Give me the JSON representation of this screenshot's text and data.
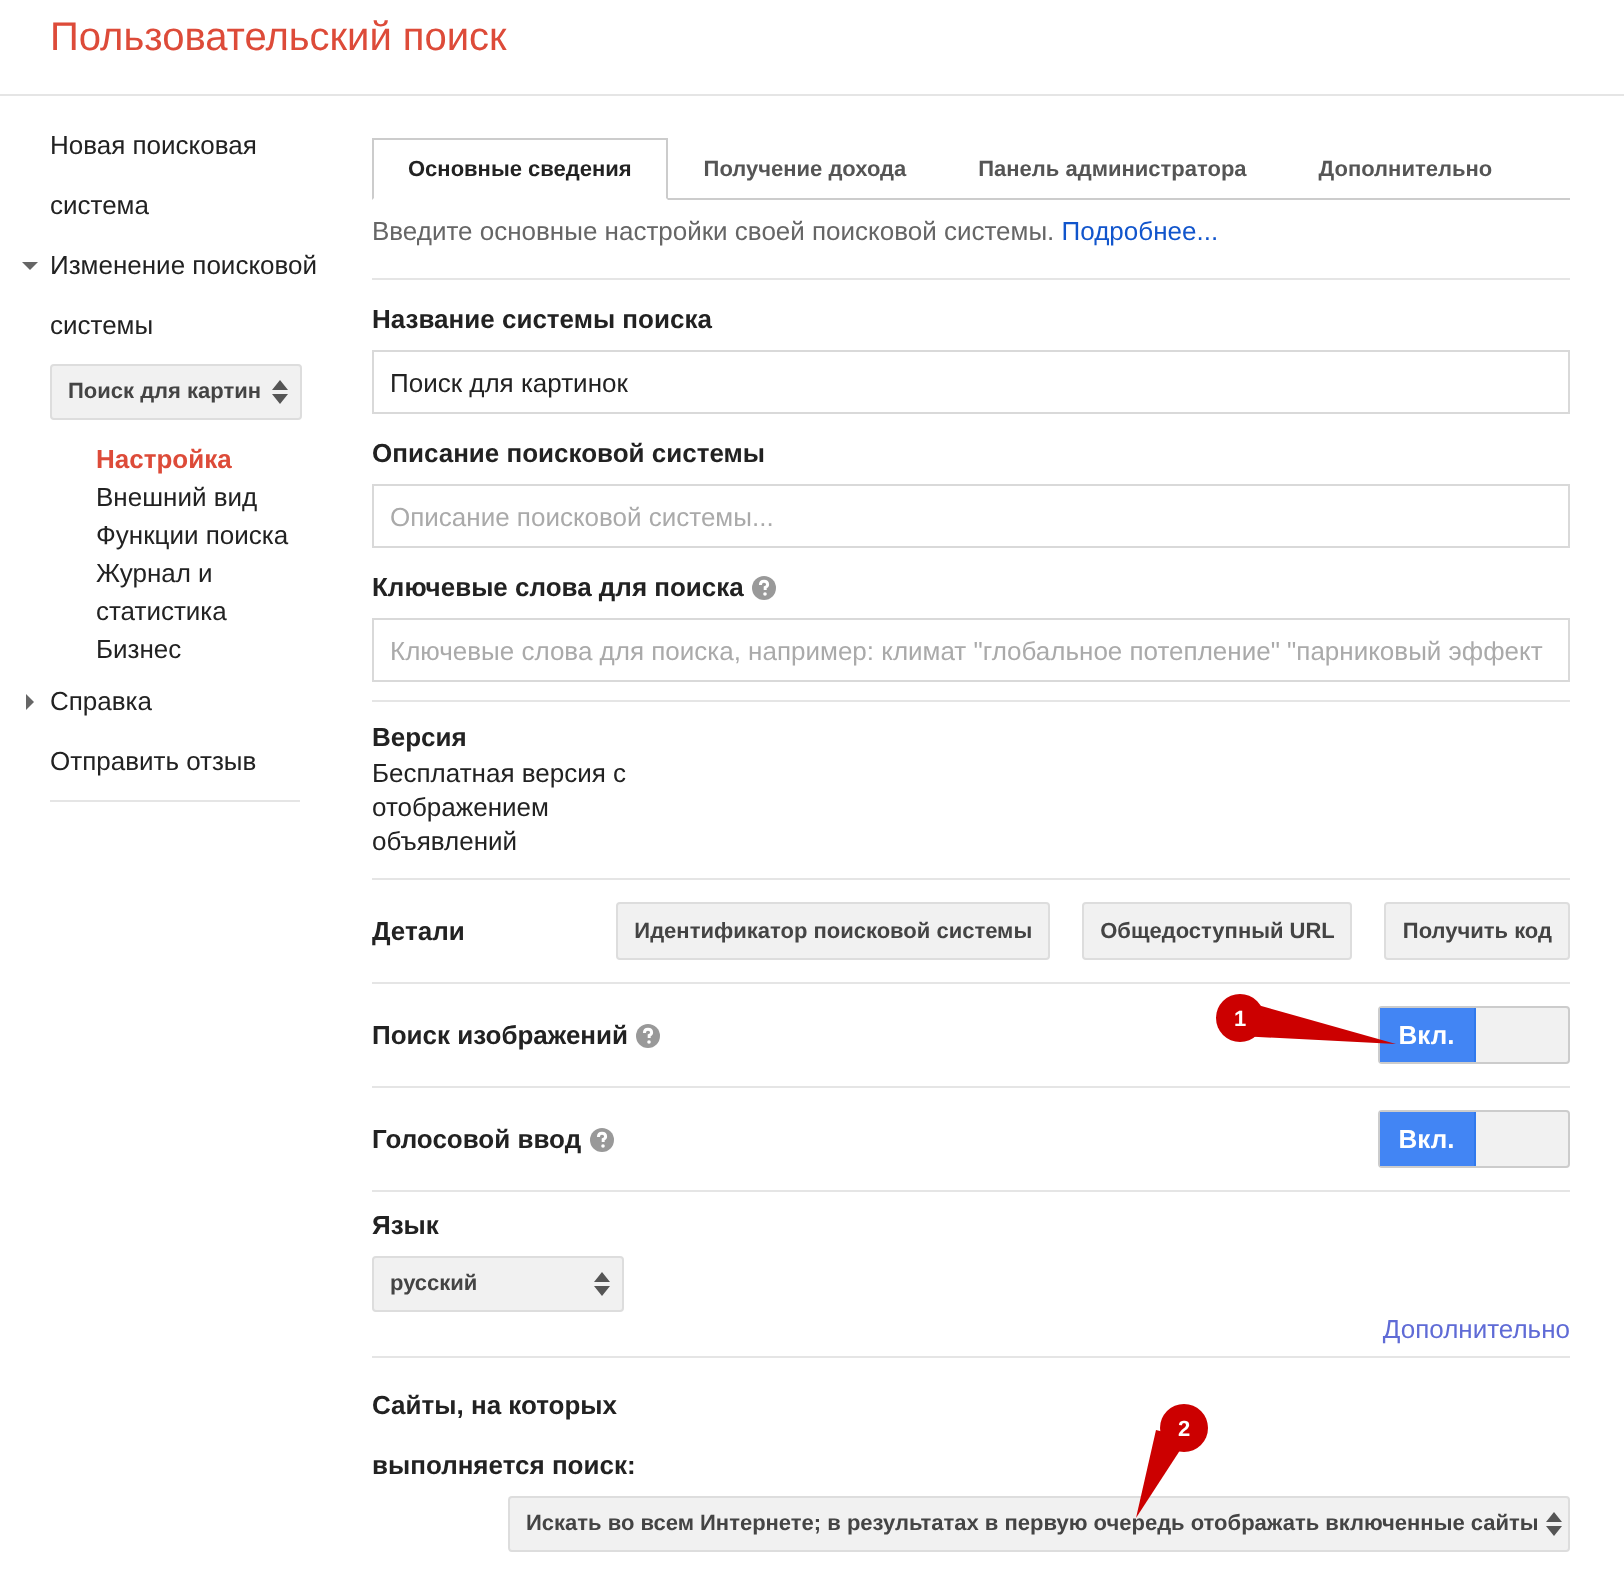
{
  "header": {
    "title": "Пользовательский поиск"
  },
  "sidebar": {
    "items": [
      {
        "kind": "link",
        "label": "Новая поисковая система"
      },
      {
        "kind": "group",
        "label": "Изменение поисковой системы",
        "expanded": true,
        "select": "Поиск для картин",
        "children": [
          {
            "label": "Настройка",
            "selected": true
          },
          {
            "label": "Внешний вид",
            "selected": false
          },
          {
            "label": "Функции поиска",
            "selected": false
          },
          {
            "label": "Журнал и статистика",
            "selected": false
          },
          {
            "label": "Бизнес",
            "selected": false
          }
        ]
      },
      {
        "kind": "group",
        "label": "Справка",
        "expanded": false
      },
      {
        "kind": "link",
        "label": "Отправить отзыв"
      }
    ]
  },
  "tabs": [
    {
      "label": "Основные сведения",
      "selected": true
    },
    {
      "label": "Получение дохода",
      "selected": false
    },
    {
      "label": "Панель администратора",
      "selected": false
    },
    {
      "label": "Дополнительно",
      "selected": false
    }
  ],
  "intro": {
    "text": "Введите основные настройки своей поисковой системы.",
    "link": "Подробнее..."
  },
  "fields": [
    {
      "label": "Название системы поиска",
      "help": false,
      "value": "Поиск для картинок"
    },
    {
      "label": "Описание поисковой системы",
      "help": false,
      "placeholder": "Описание поисковой системы..."
    },
    {
      "label": "Ключевые слова для поиска",
      "help": true,
      "placeholder": "Ключевые слова для поиска, например: климат \"глобальное потепление\" \"парниковый эффект"
    }
  ],
  "version": {
    "label": "Версия",
    "value": "Бесплатная версия с отображением объявлений"
  },
  "details": {
    "label": "Детали",
    "buttons": [
      "Идентификатор поисковой системы",
      "Общедоступный URL",
      "Получить код"
    ]
  },
  "toggles": [
    {
      "label": "Поиск изображений",
      "help": true,
      "on": true,
      "text": "Вкл.",
      "callout": "1"
    },
    {
      "label": "Голосовой ввод",
      "help": true,
      "on": true,
      "text": "Вкл."
    }
  ],
  "language": {
    "label": "Язык",
    "value": "русский",
    "link": "Дополнительно"
  },
  "sites": {
    "label": "Сайты, на которых выполняется поиск:",
    "value": "Искать во всем Интернете; в результатах в первую очередь отображать включенные сайты",
    "callout": "2"
  }
}
